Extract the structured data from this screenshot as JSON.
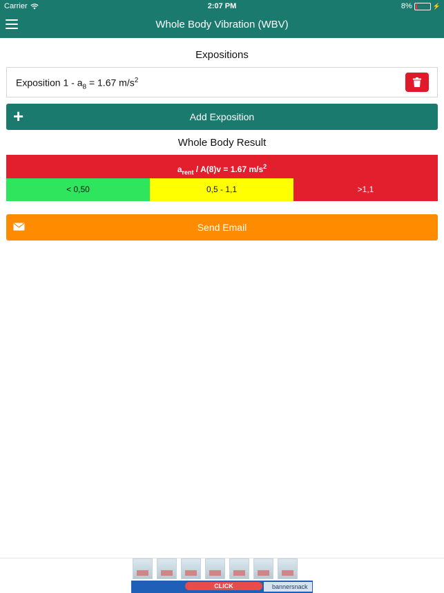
{
  "status_bar": {
    "carrier": "Carrier",
    "time": "2:07 PM",
    "battery": "8%",
    "wifi_icon": "wifi-icon",
    "battery_icon": "battery-icon"
  },
  "nav": {
    "title": "Whole Body Vibration (WBV)",
    "menu_icon": "hamburger-menu-icon"
  },
  "expositions": {
    "heading": "Expositions",
    "items": [
      {
        "label_prefix": "Exposition 1 - a",
        "label_sub": "8",
        "label_mid": " = 1.67 m/s",
        "label_sup": "2"
      }
    ],
    "delete_icon": "trash-icon"
  },
  "add_button": {
    "plus": "+",
    "label": "Add Exposition"
  },
  "result": {
    "heading": "Whole Body Result",
    "a_letter": "a",
    "a_sub": "rent",
    "formula": " / A(8)v = 1.67 m/s",
    "formula_sup": "2",
    "bar_color": "#e31f2e",
    "ranges": [
      {
        "label": "< 0,50",
        "color": "#2fe55e",
        "text_color": "#111111"
      },
      {
        "label": "0,5 - 1,1",
        "color": "#ffff00",
        "text_color": "#111111"
      },
      {
        "label": ">1,1",
        "color": "#e31f2e",
        "text_color": "#ffffff"
      }
    ]
  },
  "email_button": {
    "label": "Send Email",
    "icon": "envelope-icon",
    "color": "#ff8b00"
  },
  "ad": {
    "click_label": "CLICK",
    "brand": "bannersnack"
  },
  "colors": {
    "primary": "#1a7a6e",
    "danger": "#e0192b",
    "accent": "#ff8b00"
  }
}
